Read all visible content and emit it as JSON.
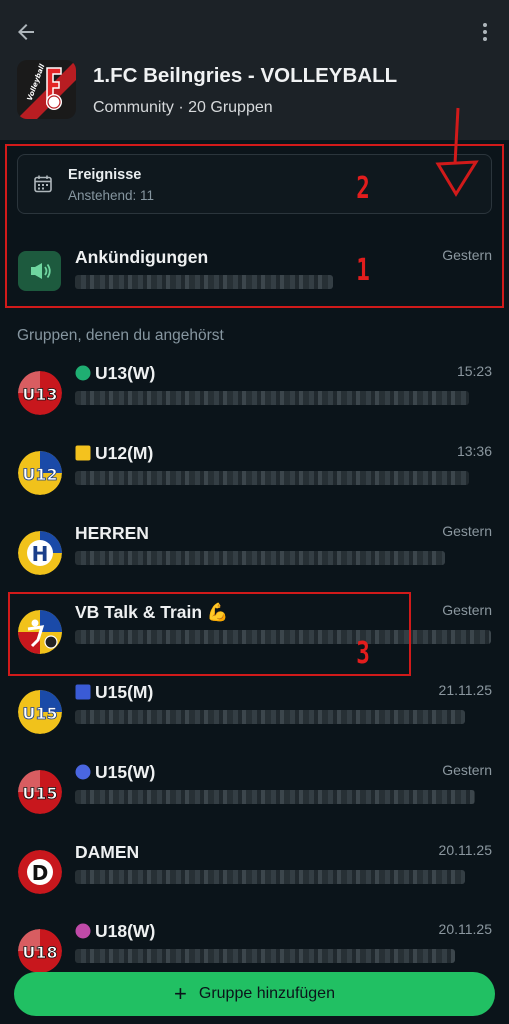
{
  "header": {
    "title": "1.FC Beilngries - VOLLEYBALL",
    "subtitle": "Community · 20 Gruppen",
    "logo_text": "Volleyball"
  },
  "events": {
    "label": "Ereignisse",
    "sub": "Anstehend: 11"
  },
  "announcements": {
    "name": "Ankündigungen",
    "time": "Gestern"
  },
  "section_title": "Gruppen, denen du angehörst",
  "groups": [
    {
      "name": "U13(W)",
      "time": "15:23",
      "badge": "U13"
    },
    {
      "name": "U12(M)",
      "time": "13:36",
      "badge": "U12"
    },
    {
      "name": "HERREN",
      "time": "Gestern",
      "badge": "H"
    },
    {
      "name": "VB Talk & Train 💪",
      "time": "Gestern",
      "badge": "VB"
    },
    {
      "name": "U15(M)",
      "time": "21.11.25",
      "badge": "U15"
    },
    {
      "name": "U15(W)",
      "time": "Gestern",
      "badge": "U15"
    },
    {
      "name": "DAMEN",
      "time": "20.11.25",
      "badge": "D"
    },
    {
      "name": "U18(W)",
      "time": "20.11.25",
      "badge": "U18"
    }
  ],
  "annotations": [
    "1",
    "2",
    "3"
  ],
  "fab": {
    "label": "Gruppe hinzufügen"
  },
  "colors": {
    "accent": "#21c063",
    "annotation": "#d11a1a",
    "background": "#0b141a",
    "header": "#1c2227"
  }
}
